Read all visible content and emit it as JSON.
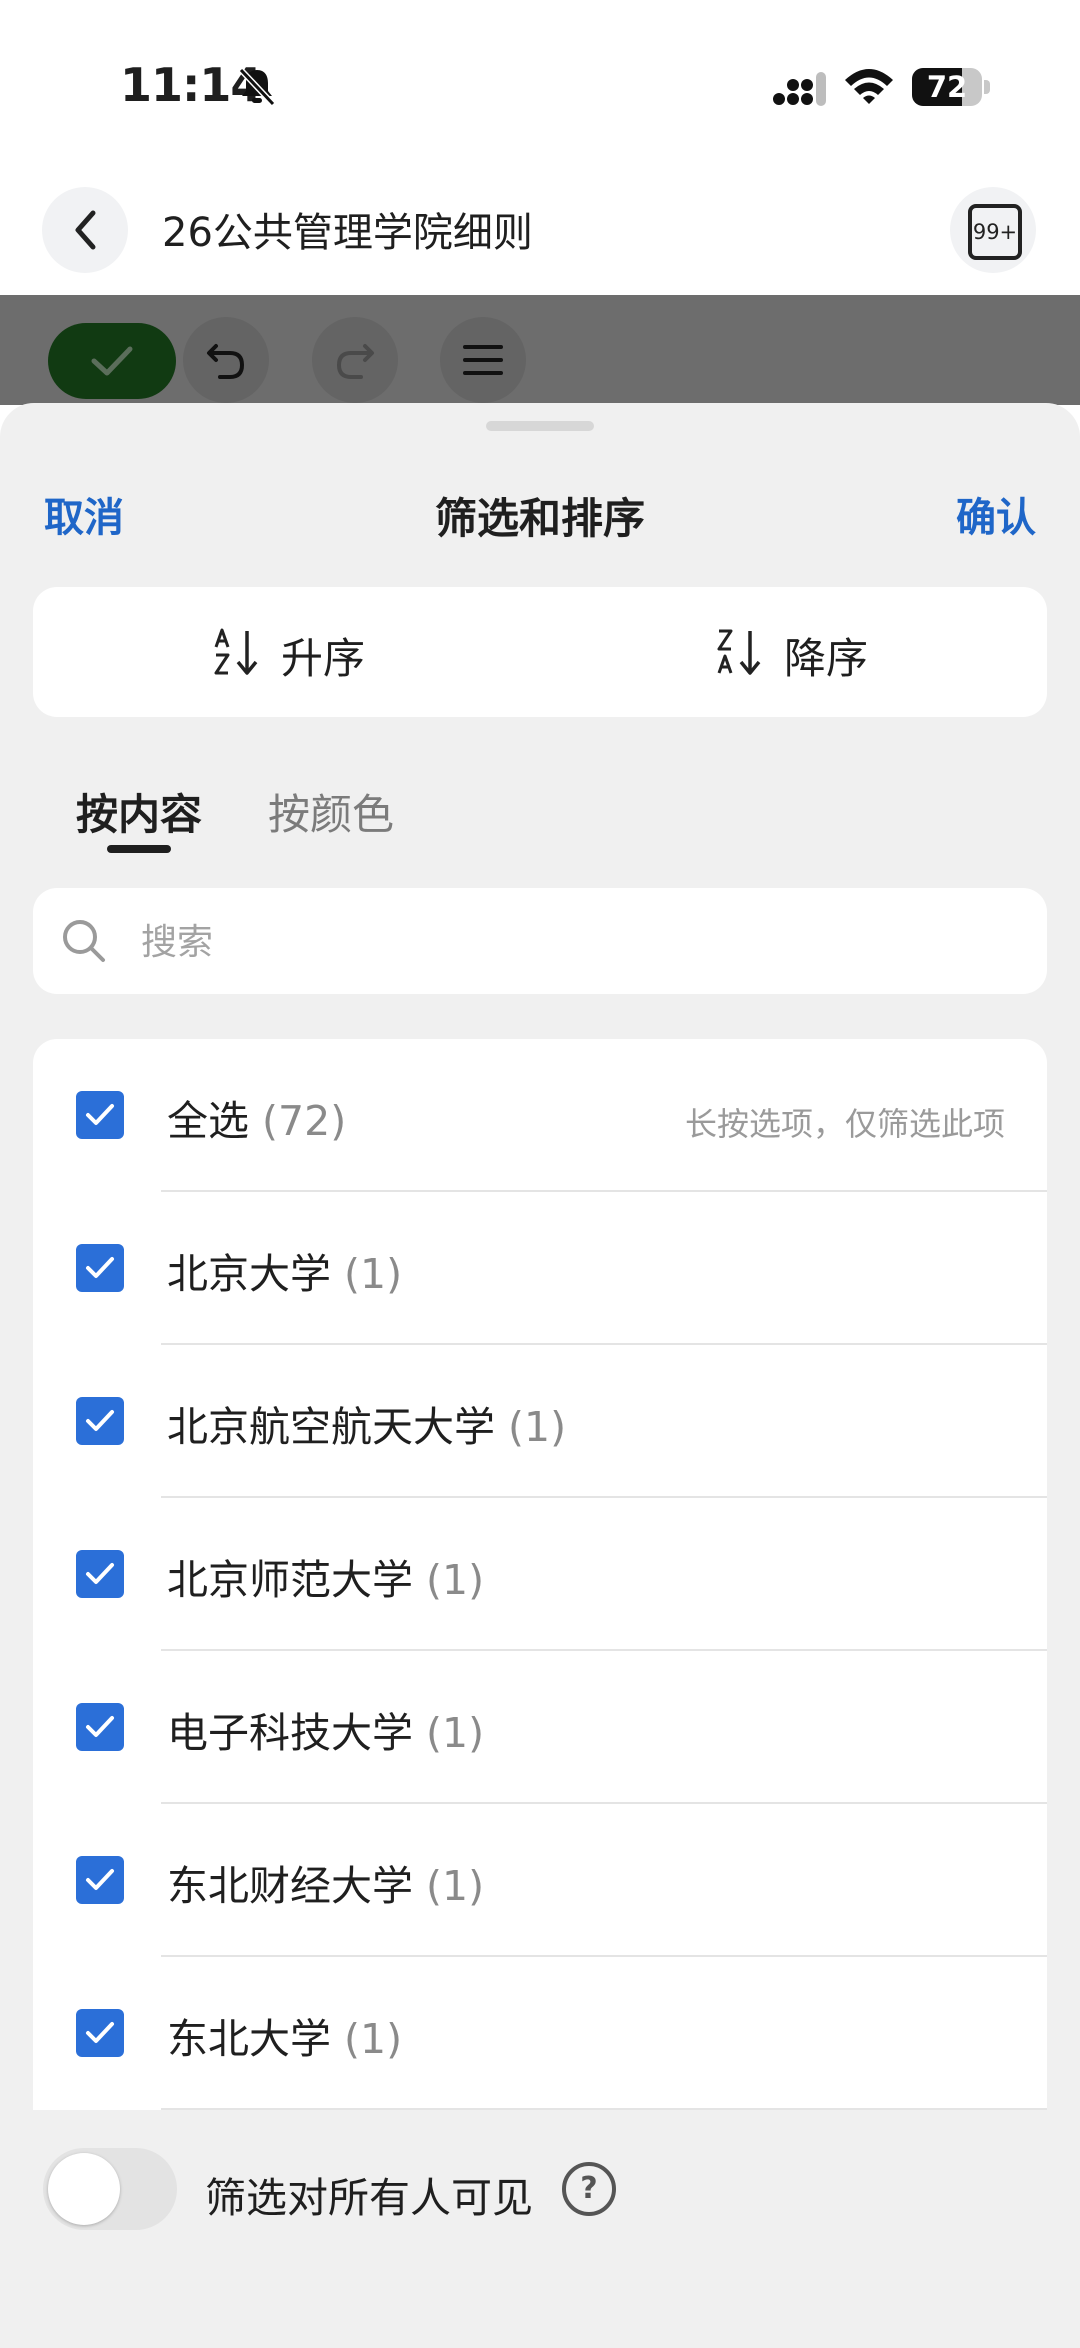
{
  "status_bar": {
    "time": "11:14",
    "battery": "72",
    "battery_level": 0.72
  },
  "header": {
    "title": "26公共管理学院细则",
    "badge": "99+"
  },
  "sheet": {
    "cancel_label": "取消",
    "title": "筛选和排序",
    "confirm_label": "确认"
  },
  "sort": {
    "ascending_label": "升序",
    "descending_label": "降序"
  },
  "tabs": [
    {
      "label": "按内容",
      "active": true
    },
    {
      "label": "按颜色",
      "active": false
    }
  ],
  "search": {
    "placeholder": "搜索",
    "value": ""
  },
  "list": {
    "select_all": {
      "label": "全选",
      "count": "(72)",
      "checked": true
    },
    "hint": "长按选项，仅筛选此项",
    "items": [
      {
        "label": "北京大学",
        "count": "(1)",
        "checked": true
      },
      {
        "label": "北京航空航天大学",
        "count": "(1)",
        "checked": true
      },
      {
        "label": "北京师范大学",
        "count": "(1)",
        "checked": true
      },
      {
        "label": "电子科技大学",
        "count": "(1)",
        "checked": true
      },
      {
        "label": "东北财经大学",
        "count": "(1)",
        "checked": true
      },
      {
        "label": "东北大学",
        "count": "(1)",
        "checked": true
      }
    ]
  },
  "visibility": {
    "label": "筛选对所有人可见",
    "enabled": false
  },
  "icons": {
    "back": "chevron-left-icon",
    "notifications": "notification-box-icon",
    "done": "check-icon",
    "undo": "undo-icon",
    "redo": "redo-icon",
    "menu": "menu-icon",
    "sort_asc": "sort-a-z-icon",
    "sort_desc": "sort-z-a-icon",
    "search": "search-icon",
    "help": "help-icon"
  },
  "colors": {
    "accent": "#1f66c8",
    "checkbox": "#2b6fd8",
    "done_button": "#113a12",
    "overlay": "#6d6d6d"
  }
}
